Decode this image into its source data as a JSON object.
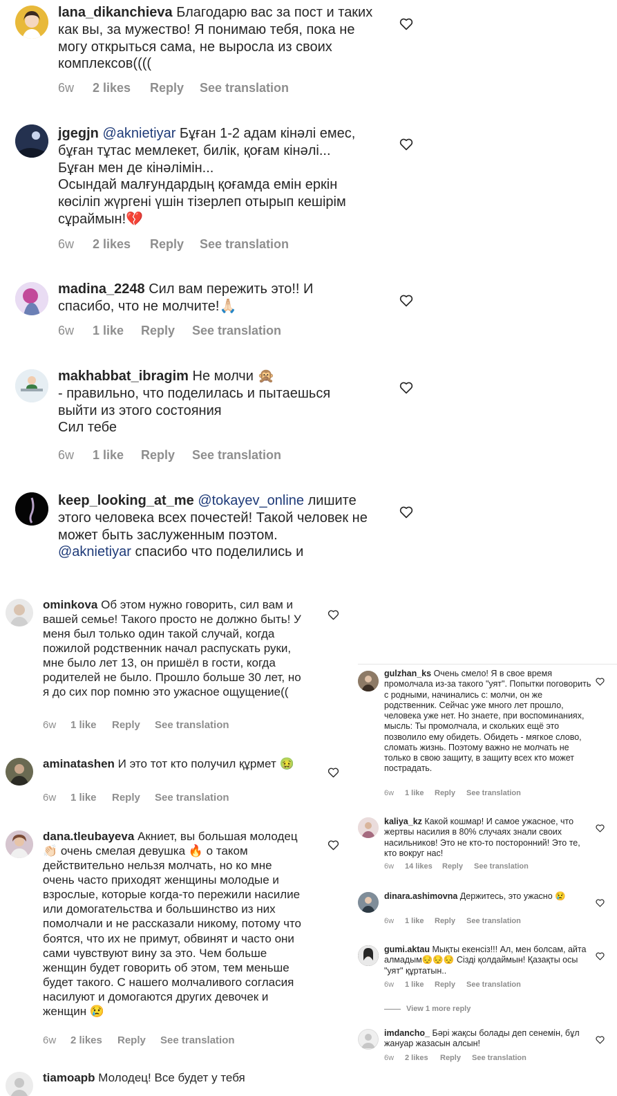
{
  "colors": {
    "text": "#262626",
    "meta": "#8e8e8e",
    "mention": "#1e3a78",
    "divider": "#e5e5e5"
  },
  "top": [
    {
      "user": "lana_dikanchieva",
      "text": "Благодарю вас за пост и таких как вы, за мужество! Я понимаю тебя, пока не могу открыться сама, не выросла из своих комплексов((((",
      "time": "6w",
      "likes": "2 likes",
      "reply": "Reply",
      "translate": "See translation",
      "avatar": "avatar-woman"
    },
    {
      "user": "jgegjn",
      "mention": "@aknietiyar",
      "text": "Бұған 1-2 адам кінәлі емес, бұған тұтас мемлекет, билік, қоғам кінәлі... Бұған мен де кінәлімін...\nОсындай малғундардың қоғамда емін еркін көсіліп жүргені үшін тізерлеп отырып кешірім сұраймын!💔",
      "time": "6w",
      "likes": "2 likes",
      "reply": "Reply",
      "translate": "See translation",
      "avatar": "avatar-night"
    },
    {
      "user": "madina_2248",
      "text": "Сил вам пережить это!! И спасибо, что не молчите!🙏🏻",
      "time": "6w",
      "likes": "1 like",
      "reply": "Reply",
      "translate": "See translation",
      "avatar": "avatar-art"
    },
    {
      "user": "makhabbat_ibragim",
      "text": "Не молчи 🙊\n- правильно, что поделилась и пытаешься выйти из этого состояния\nСил тебе",
      "time": "6w",
      "likes": "1 like",
      "reply": "Reply",
      "translate": "See translation",
      "avatar": "avatar-desk"
    },
    {
      "user": "keep_looking_at_me",
      "mention": "@tokayev_online",
      "text": "лишите этого человека всех почестей! Такой человек не может быть заслуженным поэтом.",
      "mention2": "@aknietiyar",
      "text2": "спасибо что поделились и",
      "avatar": "avatar-dark"
    }
  ],
  "left": [
    {
      "user": "ominkova",
      "text": "Об этом нужно говорить, сил вам и вашей семье! Такого просто не должно быть! У меня был только один такой случай, когда пожилой родственник начал распускать руки, мне было лет 13, он пришёл в гости, когда родителей не было. Прошло больше 30 лет, но я до сих пор помню это ужасное ощущение((",
      "time": "6w",
      "likes": "1 like",
      "reply": "Reply",
      "translate": "See translation"
    },
    {
      "user": "aminatashen",
      "text": "И это тот кто получил құрмет 🤢",
      "time": "6w",
      "likes": "1 like",
      "reply": "Reply",
      "translate": "See translation"
    },
    {
      "user": "dana.tleubayeva",
      "text": "Акниет, вы большая молодец 👏🏻 очень смелая девушка 🔥 о таком действительно нельзя молчать, но ко мне очень часто приходят женщины молодые и взрослые, которые когда-то пережили насилие или домогательства и большинство из них помолчали и не рассказали никому, потому что боятся, что их не примут, обвинят и часто они сами чувствуют вину за это. Чем больше женщин будет говорить об этом, тем меньше будет такого. С нашего молчаливого согласия насилуют и домогаются других девочек и женщин 😢",
      "time": "6w",
      "likes": "2 likes",
      "reply": "Reply",
      "translate": "See translation"
    },
    {
      "user": "tiamoapb",
      "text": "Молодец! Все будет у тебя"
    }
  ],
  "right": [
    {
      "user": "gulzhan_ks",
      "text": "Очень смело! Я в свое время промолчала из-за такого \"уят\". Попытки поговорить с родными, начинались с: молчи, он же родственник. Сейчас уже много лет прошло, человека уже нет. Но знаете, при воспоминаниях, мысль: Ты промолчала, и скольких ещё это позволило ему обидеть. Обидеть - мягкое слово, сломать жизнь. Поэтому важно не молчать не только в свою защиту, в защиту всех кто может пострадать.",
      "time": "6w",
      "likes": "1 like",
      "reply": "Reply",
      "translate": "See translation"
    },
    {
      "user": "kaliya_kz",
      "text": "Какой кошмар! И самое ужасное, что жертвы насилия в 80% случаях знали своих насильников! Это не кто-то посторонний! Это те, кто вокруг нас!",
      "time": "6w",
      "likes": "14 likes",
      "reply": "Reply",
      "translate": "See translation"
    },
    {
      "user": "dinara.ashimovna",
      "text": "Держитесь, это ужасно 😢",
      "time": "6w",
      "likes": "1 like",
      "reply": "Reply",
      "translate": "See translation"
    },
    {
      "user": "gumi.aktau",
      "text": "Мықты екенсіз!!! Ал, мен болсам, айта алмадым😔😔😔 Сізді қолдаймын! Қазақты осы \"уят\" құртатын..",
      "time": "6w",
      "likes": "1 like",
      "reply": "Reply",
      "translate": "See translation"
    },
    {
      "view_more": "View 1 more reply"
    },
    {
      "user": "imdancho_",
      "text": "Бәрі жақсы болады деп сенемін, бұл жануар жазасын алсын!",
      "time": "6w",
      "likes": "2 likes",
      "reply": "Reply",
      "translate": "See translation"
    }
  ]
}
